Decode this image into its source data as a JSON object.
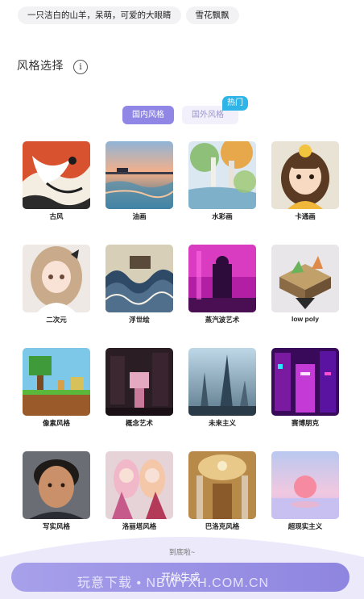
{
  "prompts": [
    "一只洁白的山羊，呆萌，可爱的大眼睛",
    "雪花飘飘"
  ],
  "section_title": "风格选择",
  "info_icon": "info-icon",
  "tabs": [
    {
      "label": "国内风格",
      "active": true
    },
    {
      "label": "国外风格",
      "active": false
    }
  ],
  "hot_badge": "热门",
  "styles": [
    {
      "label": "古风"
    },
    {
      "label": "油画"
    },
    {
      "label": "水彩画"
    },
    {
      "label": "卡通画"
    },
    {
      "label": "二次元"
    },
    {
      "label": "浮世绘"
    },
    {
      "label": "蒸汽波艺术"
    },
    {
      "label": "low poly"
    },
    {
      "label": "像素风格"
    },
    {
      "label": "概念艺术"
    },
    {
      "label": "未来主义"
    },
    {
      "label": "赛博朋克"
    },
    {
      "label": "写实风格"
    },
    {
      "label": "洛丽塔风格"
    },
    {
      "label": "巴洛克风格"
    },
    {
      "label": "超现实主义"
    }
  ],
  "end_text": "到底啦~",
  "generate_button": "开始生成",
  "watermark": "玩意下载 • NBWYXH.COM.CN",
  "colors": {
    "accent": "#8f86e6",
    "hot": "#2fb4e8"
  }
}
